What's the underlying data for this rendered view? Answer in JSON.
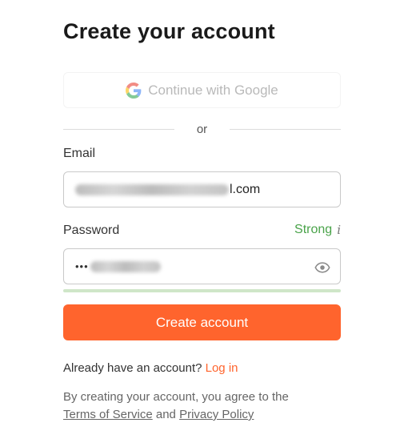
{
  "title": "Create your account",
  "google": {
    "label": "Continue with Google"
  },
  "divider": {
    "text": "or"
  },
  "email": {
    "label": "Email",
    "value_visible_tail": "l.com"
  },
  "password": {
    "label": "Password",
    "dots": "•••",
    "strength": "Strong",
    "info_glyph": "i",
    "strength_level": 1.0
  },
  "create_button": {
    "label": "Create account"
  },
  "login_prompt": {
    "text": "Already have an account?",
    "link": "Log in"
  },
  "terms": {
    "prefix": "By creating your account, you agree to the",
    "tos": "Terms of Service",
    "and": "and",
    "privacy": "Privacy Policy"
  },
  "colors": {
    "accent": "#ff642d",
    "strong": "#4aa34a",
    "strength_bar": "#cfe6c8"
  }
}
